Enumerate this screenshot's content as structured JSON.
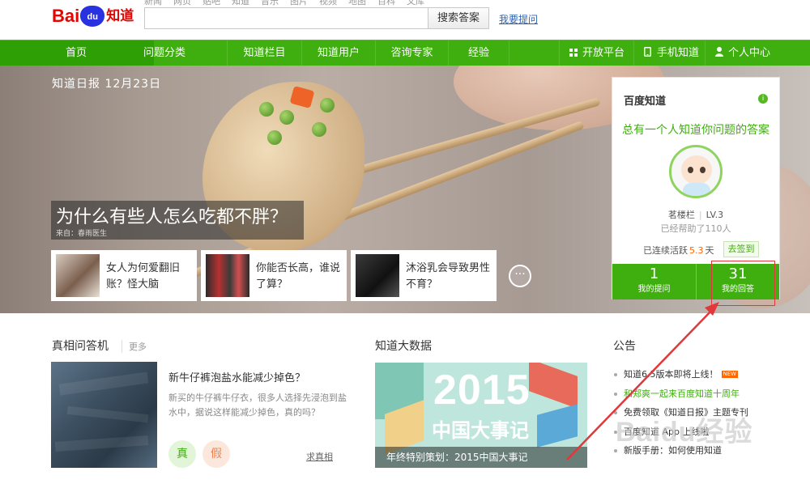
{
  "header": {
    "logo_bai": "Bai",
    "logo_du": "du",
    "logo_zhidao": "知道",
    "top_links": [
      "新闻",
      "网页",
      "贴吧",
      "知道",
      "音乐",
      "图片",
      "视频",
      "地图",
      "百科",
      "文库"
    ],
    "search_value": "",
    "search_button": "搜索答案",
    "ask_link": "我要提问"
  },
  "nav": {
    "items": [
      "首页",
      "问题分类",
      "知道栏目",
      "知道用户",
      "咨询专家",
      "经验"
    ],
    "right_items": [
      "开放平台",
      "手机知道",
      "个人中心"
    ]
  },
  "banner": {
    "date": "知道日报 12月23日",
    "headline": "为什么有些人怎么吃都不胖？",
    "source": "来自：春雨医生",
    "cards": [
      {
        "text": "女人为何爱翻旧账？怪大脑"
      },
      {
        "text": "你能否长高，谁说了算？"
      },
      {
        "text": "沐浴乳会导致男性不育？"
      }
    ],
    "more": "···"
  },
  "panel": {
    "title": "百度知道",
    "info": "i",
    "slogan": "总有一个人知道你问题的答案",
    "username": "茗楼栏",
    "level": "LV.3",
    "helped": "已经帮助了110人",
    "checkin_prefix": "已连续活跃",
    "checkin_days": "5.3",
    "checkin_suffix": "天",
    "checkin_button": "去签到",
    "questions_count": "1",
    "questions_label": "我的提问",
    "answers_count": "31",
    "answers_label": "我的回答"
  },
  "truth_machine": {
    "title": "真相问答机",
    "more": "更多",
    "question": "新牛仔裤泡盐水能减少掉色？",
    "desc": "新买的牛仔裤牛仔衣，很多人选择先浸泡到盐水中，据说这样能减少掉色，真的吗？",
    "true_label": "真",
    "false_label": "假",
    "seek_link": "求真相"
  },
  "big_data": {
    "title": "知道大数据",
    "image_year": "2015",
    "image_title": "中国大事记",
    "caption": "年终特别策划：2015中国大事记"
  },
  "notices": {
    "title": "公告",
    "items": [
      {
        "text": "知道6.5版本即将上线！",
        "badge": "NEW"
      },
      {
        "text": "和郑爽一起来百度知道十周年",
        "badge": ""
      },
      {
        "text": "免费领取《知道日报》主题专刊",
        "badge": ""
      },
      {
        "text": "百度知道 App 上线啦",
        "badge": ""
      },
      {
        "text": "新版手册：如何使用知道",
        "badge": ""
      }
    ]
  },
  "watermark": "Baidu经验",
  "colors": {
    "brand_green": "#3eaf0e",
    "highlight_red": "#e0383b",
    "baidu_red": "#e10602",
    "baidu_blue": "#2932e1"
  }
}
